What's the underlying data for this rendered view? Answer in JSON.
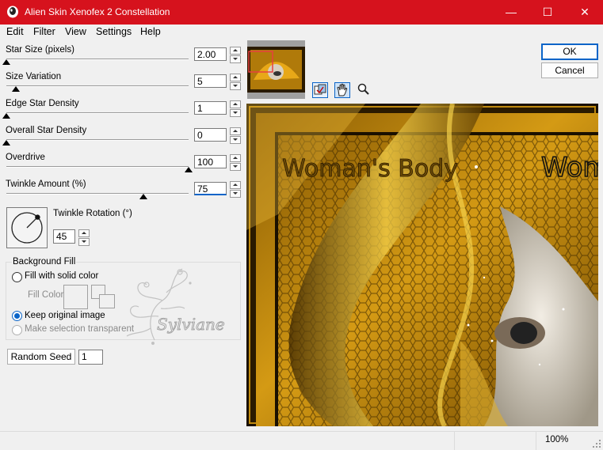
{
  "window": {
    "title": "Alien Skin Xenofex 2 Constellation",
    "minimize_glyph": "—",
    "maximize_glyph": "☐",
    "close_glyph": "✕"
  },
  "menu": [
    "Edit",
    "Filter",
    "View",
    "Settings",
    "Help"
  ],
  "params": [
    {
      "label": "Star Size (pixels)",
      "value": "2.00",
      "slider": 0.0
    },
    {
      "label": "Size Variation",
      "value": "5",
      "slider": 0.05
    },
    {
      "label": "Edge Star Density",
      "value": "1",
      "slider": 0.0
    },
    {
      "label": "Overall Star Density",
      "value": "0",
      "slider": 0.0
    },
    {
      "label": "Overdrive",
      "value": "100",
      "slider": 1.0
    },
    {
      "label": "Twinkle Amount (%)",
      "value": "75",
      "slider": 0.75
    }
  ],
  "rotation": {
    "label": "Twinkle Rotation (°)",
    "value": "45",
    "angle": 45
  },
  "background_fill": {
    "title": "Background Fill",
    "solid_label": "Fill with solid color",
    "fill_color_label": "Fill Color",
    "keep_label": "Keep original image",
    "transparent_label": "Make selection transparent",
    "selected": "keep"
  },
  "random_seed": {
    "label": "Random Seed",
    "value": "1"
  },
  "buttons": {
    "ok": "OK",
    "cancel": "Cancel"
  },
  "watermark": "Sylviane",
  "preview_text": {
    "left": "Woman's Body",
    "right": "Wom"
  },
  "status": {
    "zoom": "100%"
  },
  "colors": {
    "titlebar": "#d6121d",
    "accent": "#0a64c8",
    "gold": "#c89410"
  }
}
